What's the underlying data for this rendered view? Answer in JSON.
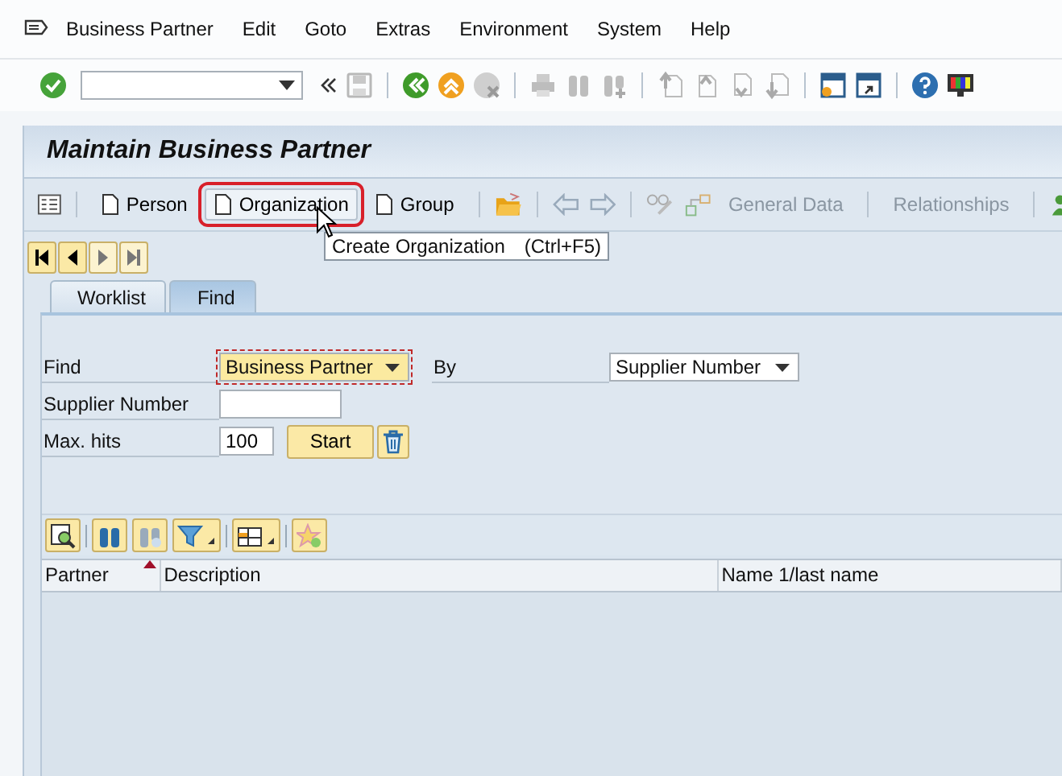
{
  "menu_bar": {
    "items": [
      "Business Partner",
      "Edit",
      "Goto",
      "Extras",
      "Environment",
      "System",
      "Help"
    ]
  },
  "title": "Maintain Business Partner",
  "app_toolbar": {
    "create_buttons": [
      {
        "label": "Person",
        "highlighted": false
      },
      {
        "label": "Organization",
        "highlighted": true
      },
      {
        "label": "Group",
        "highlighted": false
      }
    ],
    "text_buttons": [
      {
        "label": "General Data",
        "disabled": true
      },
      {
        "label": "Relationships",
        "disabled": true
      }
    ]
  },
  "tooltip": {
    "text": "Create Organization",
    "shortcut": "(Ctrl+F5)"
  },
  "tabs": [
    {
      "label": "Worklist",
      "selected": false
    },
    {
      "label": "Find",
      "selected": true
    }
  ],
  "find_form": {
    "find_label": "Find",
    "find_value": "Business Partner",
    "by_label": "By",
    "by_value": "Supplier Number",
    "supplier_label": "Supplier Number",
    "max_hits_label": "Max. hits",
    "max_hits_value": "100",
    "start_button": "Start"
  },
  "results_table": {
    "columns": [
      {
        "label": "Partner",
        "sorted": true
      },
      {
        "label": "Description",
        "sorted": false
      },
      {
        "label": "Name 1/last name",
        "sorted": false
      }
    ]
  }
}
